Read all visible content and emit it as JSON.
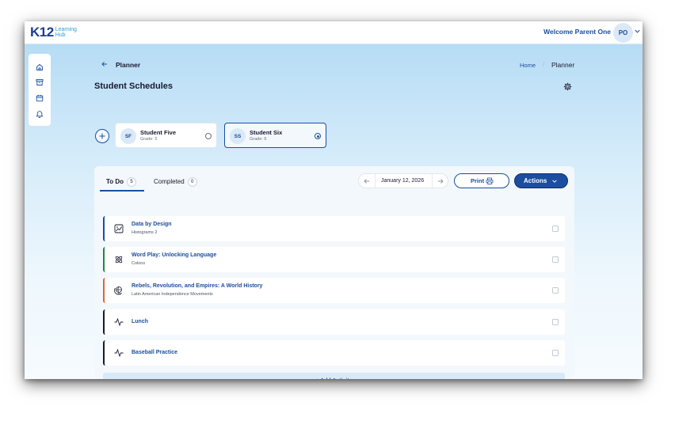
{
  "brand": {
    "name": "K12",
    "sub1": "Learning",
    "sub2": "Hub"
  },
  "topbar": {
    "welcome": "Welcome Parent One",
    "avatar_initials": "PO"
  },
  "sidenav": {
    "items": [
      "home-icon",
      "archive-icon",
      "calendar-icon",
      "bell-icon"
    ]
  },
  "header": {
    "title": "Planner"
  },
  "breadcrumb": {
    "home": "Home",
    "separator": "/",
    "current": "Planner"
  },
  "schedules": {
    "title": "Student Schedules",
    "students": [
      {
        "initials": "SF",
        "name": "Student Five",
        "grade": "Grade: 5",
        "selected": false
      },
      {
        "initials": "SS",
        "name": "Student Six",
        "grade": "Grade: 6",
        "selected": true
      }
    ]
  },
  "tabs": [
    {
      "label": "To Do",
      "count": "5",
      "active": true
    },
    {
      "label": "Completed",
      "count": "0",
      "active": false
    }
  ],
  "date": "January 12, 2026",
  "buttons": {
    "print": "Print",
    "actions": "Actions"
  },
  "activities": [
    {
      "title": "Data by Design",
      "subtitle": "Histograms 2",
      "icon": "chart-icon",
      "color": "#1b4ea0"
    },
    {
      "title": "Word Play: Unlocking Language",
      "subtitle": "Colons",
      "icon": "atom-icon",
      "color": "#1e8a3c"
    },
    {
      "title": "Rebels, Revolution, and Empires: A World History",
      "subtitle": "Latin American Independence Movements",
      "icon": "globe-icon",
      "color": "#e0652a"
    },
    {
      "title": "Lunch",
      "subtitle": "",
      "icon": "activity-icon",
      "color": "#1a1a2e"
    },
    {
      "title": "Baseball Practice",
      "subtitle": "",
      "icon": "activity-icon",
      "color": "#1a1a2e"
    }
  ],
  "add_activity": "+ Add Activity"
}
